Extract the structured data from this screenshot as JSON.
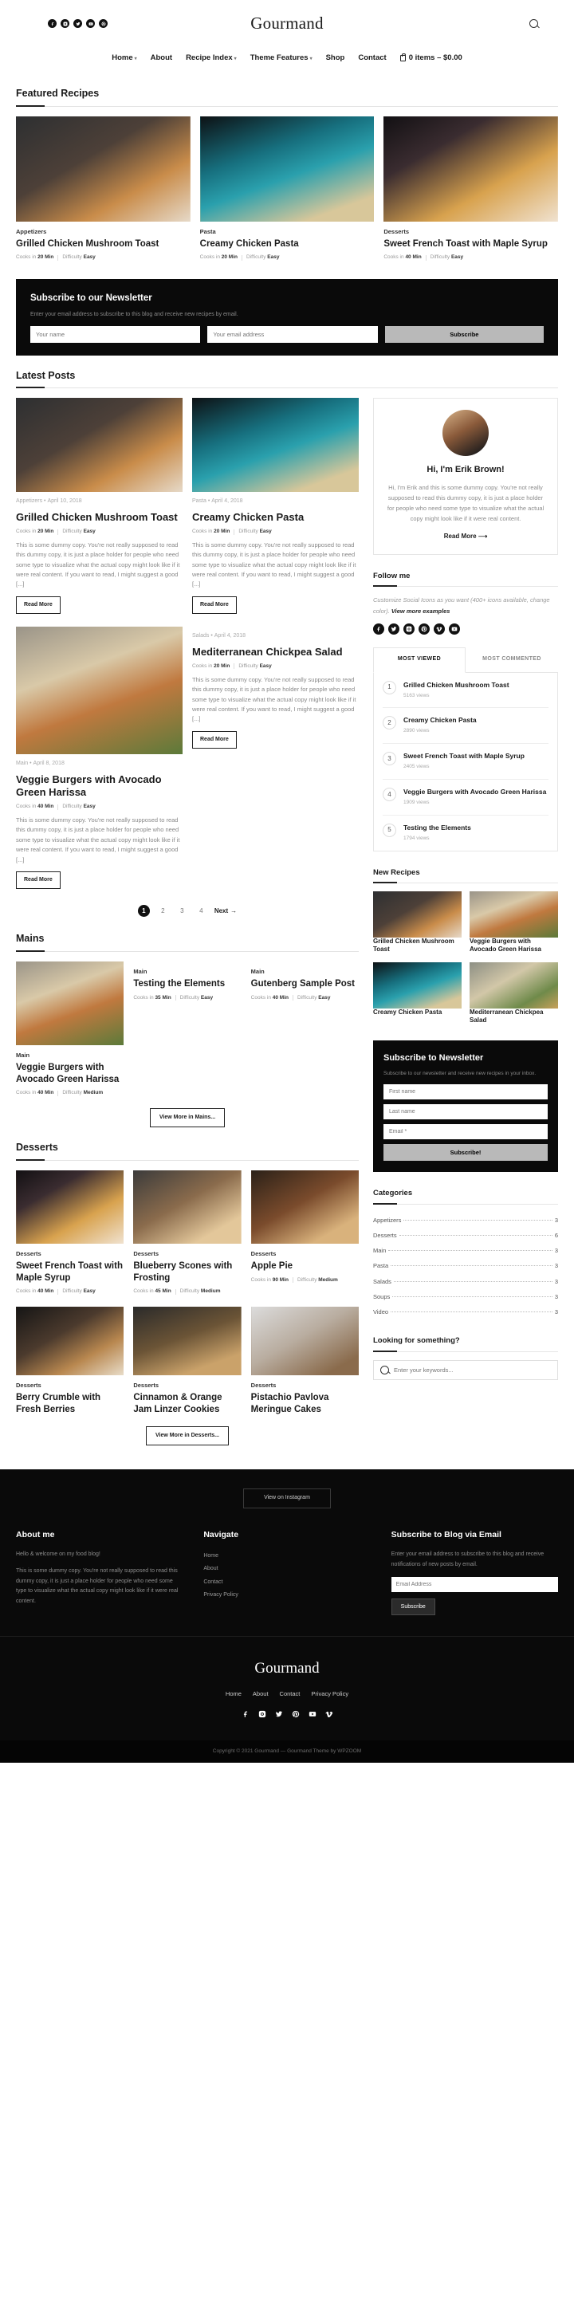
{
  "header": {
    "brand": "Gourmand",
    "social": [
      "facebook-icon",
      "instagram-icon",
      "twitter-icon",
      "youtube-icon",
      "pinterest-icon"
    ],
    "search_icon": "search-icon",
    "nav": [
      {
        "label": "Home",
        "caret": true
      },
      {
        "label": "About",
        "caret": false
      },
      {
        "label": "Recipe Index",
        "caret": true
      },
      {
        "label": "Theme Features",
        "caret": true
      },
      {
        "label": "Shop",
        "caret": false
      },
      {
        "label": "Contact",
        "caret": false
      }
    ],
    "cart": "0 items – $0.00"
  },
  "featured": {
    "heading": "Featured Recipes",
    "cards": [
      {
        "cat": "Appetizers",
        "title": "Grilled Chicken Mushroom Toast",
        "cooks_label": "Cooks in",
        "cooks": "20 Min",
        "diff_label": "Difficulty",
        "diff": "Easy"
      },
      {
        "cat": "Pasta",
        "title": "Creamy Chicken Pasta",
        "cooks_label": "Cooks in",
        "cooks": "20 Min",
        "diff_label": "Difficulty",
        "diff": "Easy"
      },
      {
        "cat": "Desserts",
        "title": "Sweet French Toast with Maple Syrup",
        "cooks_label": "Cooks in",
        "cooks": "40 Min",
        "diff_label": "Difficulty",
        "diff": "Easy"
      }
    ]
  },
  "newsletter": {
    "title": "Subscribe to our Newsletter",
    "desc": "Enter your email address to subscribe to this blog and receive new recipes by email.",
    "name_placeholder": "Your name",
    "email_placeholder": "Your email address",
    "button": "Subscribe"
  },
  "latest": {
    "heading": "Latest Posts",
    "excerpt": "This is some dummy copy. You're not really supposed to read this dummy copy, it is just a place holder for people who need some type to visualize what the actual copy might look like if it were real content. If you want to read, I might suggest a good [...]",
    "read_more": "Read More",
    "posts": [
      {
        "cat": "Appetizers",
        "date": "April 10, 2018",
        "title": "Grilled Chicken Mushroom Toast",
        "cooks": "20 Min",
        "diff": "Easy"
      },
      {
        "cat": "Main",
        "date": "April 8, 2018",
        "title": "Veggie Burgers with Avocado Green Harissa",
        "cooks": "40 Min",
        "diff": "Easy"
      },
      {
        "cat": "Pasta",
        "date": "April 4, 2018",
        "title": "Creamy Chicken Pasta",
        "cooks": "20 Min",
        "diff": "Easy"
      },
      {
        "cat": "Salads",
        "date": "April 4, 2018",
        "title": "Mediterranean Chickpea Salad",
        "cooks": "20 Min",
        "diff": "Easy"
      }
    ]
  },
  "pagination": {
    "pages": [
      "1",
      "2",
      "3",
      "4"
    ],
    "active": "1",
    "next": "Next"
  },
  "mains": {
    "heading": "Mains",
    "more": "View More in Mains...",
    "cards": [
      {
        "cat": "Main",
        "title": "Veggie Burgers with Avocado Green Harissa",
        "cooks": "40 Min",
        "diff": "Medium"
      },
      {
        "cat": "Main",
        "title": "Testing the Elements",
        "cooks": "35 Min",
        "diff": "Easy"
      },
      {
        "cat": "Main",
        "title": "Gutenberg Sample Post",
        "cooks": "40 Min",
        "diff": "Easy"
      }
    ]
  },
  "desserts": {
    "heading": "Desserts",
    "more": "View More in Desserts...",
    "cards": [
      {
        "cat": "Desserts",
        "title": "Sweet French Toast with Maple Syrup",
        "cooks": "40 Min",
        "diff": "Easy"
      },
      {
        "cat": "Desserts",
        "title": "Blueberry Scones with Frosting",
        "cooks": "45 Min",
        "diff": "Medium"
      },
      {
        "cat": "Desserts",
        "title": "Apple Pie",
        "cooks": "90 Min",
        "diff": "Medium"
      },
      {
        "cat": "Desserts",
        "title": "Berry Crumble with Fresh Berries",
        "cooks": "",
        "diff": ""
      },
      {
        "cat": "Desserts",
        "title": "Cinnamon & Orange Jam Linzer Cookies",
        "cooks": "",
        "diff": ""
      },
      {
        "cat": "Desserts",
        "title": "Pistachio Pavlova Meringue Cakes",
        "cooks": "",
        "diff": ""
      }
    ]
  },
  "sidebar": {
    "about": {
      "avatar": "author-photo",
      "title": "Hi, I'm Erik Brown!",
      "text": "Hi, I'm Erik and this is some dummy copy. You're not really supposed to read this dummy copy, it is just a place holder for people who need some type to visualize what the actual copy might look like if it were real content.",
      "read_more": "Read More"
    },
    "follow": {
      "title": "Follow me",
      "text_a": "Customize Social Icons as you want (400+ icons available, change color). ",
      "text_b": "View more examples",
      "icons": [
        "facebook-icon",
        "twitter-icon",
        "instagram-icon",
        "pinterest-icon",
        "vimeo-icon",
        "youtube-icon"
      ]
    },
    "ranks": {
      "tabs": [
        "MOST VIEWED",
        "MOST COMMENTED"
      ],
      "active_tab": "MOST VIEWED",
      "items": [
        {
          "n": "1",
          "title": "Grilled Chicken Mushroom Toast",
          "views": "5163 views"
        },
        {
          "n": "2",
          "title": "Creamy Chicken Pasta",
          "views": "2890 views"
        },
        {
          "n": "3",
          "title": "Sweet French Toast with Maple Syrup",
          "views": "2405 views"
        },
        {
          "n": "4",
          "title": "Veggie Burgers with Avocado Green Harissa",
          "views": "1909 views"
        },
        {
          "n": "5",
          "title": "Testing the Elements",
          "views": "1794 views"
        }
      ]
    },
    "new_recipes": {
      "title": "New Recipes",
      "items": [
        {
          "cat": "",
          "title": "Grilled Chicken Mushroom Toast"
        },
        {
          "cat": "",
          "title": "Veggie Burgers with Avocado Green Harissa"
        },
        {
          "cat": "",
          "title": "Creamy Chicken Pasta"
        },
        {
          "cat": "",
          "title": "Mediterranean Chickpea Salad"
        }
      ]
    },
    "subscribe": {
      "title": "Subscribe to Newsletter",
      "desc": "Subscribe to our newsletter and receive new recipes in your inbox.",
      "first_name": "First name",
      "last_name": "Last name",
      "email": "Email *",
      "button": "Subscribe!"
    },
    "categories": {
      "title": "Categories",
      "items": [
        {
          "name": "Appetizers",
          "count": "3"
        },
        {
          "name": "Desserts",
          "count": "6"
        },
        {
          "name": "Main",
          "count": "3"
        },
        {
          "name": "Pasta",
          "count": "3"
        },
        {
          "name": "Salads",
          "count": "3"
        },
        {
          "name": "Soups",
          "count": "3"
        },
        {
          "name": "Video",
          "count": "3"
        }
      ]
    },
    "search": {
      "title": "Looking for something?",
      "placeholder": "Enter your keywords..."
    }
  },
  "footer": {
    "instagram_button": "View on Instagram",
    "about": {
      "title": "About me",
      "p1": "Hello & welcome on my food blog!",
      "p2": "This is some dummy copy. You're not really supposed to read this dummy copy, it is just a place holder for people who need some type to visualize what the actual copy might look like if it were real content."
    },
    "navigate": {
      "title": "Navigate",
      "items": [
        "Home",
        "About",
        "Contact",
        "Privacy Policy"
      ]
    },
    "subscribe": {
      "title": "Subscribe to Blog via Email",
      "desc": "Enter your email address to subscribe to this blog and receive notifications of new posts by email.",
      "placeholder": "Email Address",
      "button": "Subscribe"
    },
    "brand": "Gourmand",
    "nav": [
      "Home",
      "About",
      "Contact",
      "Privacy Policy"
    ],
    "social": [
      "facebook-icon",
      "instagram-icon",
      "twitter-icon",
      "pinterest-icon",
      "youtube-icon",
      "vimeo-icon"
    ],
    "copyright": "Copyright © 2021 Gourmand — Gourmand Theme by WPZOOM"
  }
}
